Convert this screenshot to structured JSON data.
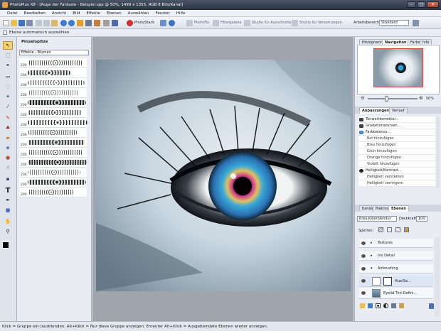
{
  "window": {
    "title": "PhotoPlus X8 - [Auge der Fantasie - Beispiel.spp @ 50%, 1499 x 1355, RGB 8 Bits/Kanal]",
    "minimize": "–",
    "maximize": "□",
    "close": "✕"
  },
  "menu": [
    "Datei",
    "Bearbeiten",
    "Ansicht",
    "Bild",
    "Effekte",
    "Ebenen",
    "Auswählen",
    "Fenster",
    "Hilfe"
  ],
  "toolbar": {
    "photostack": "PhotoStack",
    "photofix": "PhotoFix",
    "filtergalerie": "Filtergalerie",
    "studio_ausschnitte": "Studio für Ausschnitte",
    "studio_verzerrungen": "Studio für Verzerrungen",
    "arbeitsbereich_label": "Arbeitsbereich",
    "arbeitsbereich_value": "Standard"
  },
  "context_toolbar": {
    "auto_select_label": "Ebene automatisch auswählen"
  },
  "brush_panel": {
    "tab": "Pinselspitze",
    "category": "Effekte - Blumen",
    "brush_size": "200"
  },
  "navigator": {
    "tabs": [
      "Histogramm",
      "Navigation",
      "Farbe",
      "Info"
    ],
    "active_tab": "Navigation",
    "zoom": "50%"
  },
  "adjustments": {
    "tabs": [
      "Anpassungen",
      "Verlauf"
    ],
    "items": [
      {
        "label": "Tonwertkorrektur...",
        "icon_color": "#404040",
        "sub": false
      },
      {
        "label": "Gradationskurven...",
        "icon_color": "#404040",
        "sub": false
      },
      {
        "label": "Farbbalance...",
        "icon_color": "#4a8ad0",
        "sub": false
      },
      {
        "label": "Rot hinzufügen",
        "sub": true
      },
      {
        "label": "Blau hinzufügen",
        "sub": true
      },
      {
        "label": "Grün hinzufügen",
        "sub": true
      },
      {
        "label": "Orange hinzufügen",
        "sub": true
      },
      {
        "label": "Violett hinzufügen",
        "sub": true
      },
      {
        "label": "Helligkeit/Kontrast...",
        "icon_color": "#202020",
        "sub": false
      },
      {
        "label": "Helligkeit verstärken",
        "sub": true
      },
      {
        "label": "Helligkeit verringern",
        "sub": true
      }
    ]
  },
  "layers": {
    "tabs": [
      "Kanäle",
      "Makros",
      "Ebenen"
    ],
    "active_tab": "Ebenen",
    "blend_mode": "Kreuzüberblendur",
    "opacity_label": "Deckkraft:",
    "opacity_value": "100",
    "lock_label": "Sperren:",
    "items": [
      {
        "name": "Textures",
        "type": "group"
      },
      {
        "name": "Iris Detail",
        "type": "group"
      },
      {
        "name": "Airbrushing",
        "type": "group-open"
      },
      {
        "name": "Hue/Sa...",
        "type": "adjustment"
      },
      {
        "name": "Eyelid Tint Defini...",
        "type": "layer"
      }
    ]
  },
  "status": {
    "text": "Klick = Gruppe ein-/ausblenden. Alt+Klick = Nur diese Gruppe anzeigen. Erneuter Alt+Klick = Ausgeblendete Ebenen wieder anzeigen."
  }
}
